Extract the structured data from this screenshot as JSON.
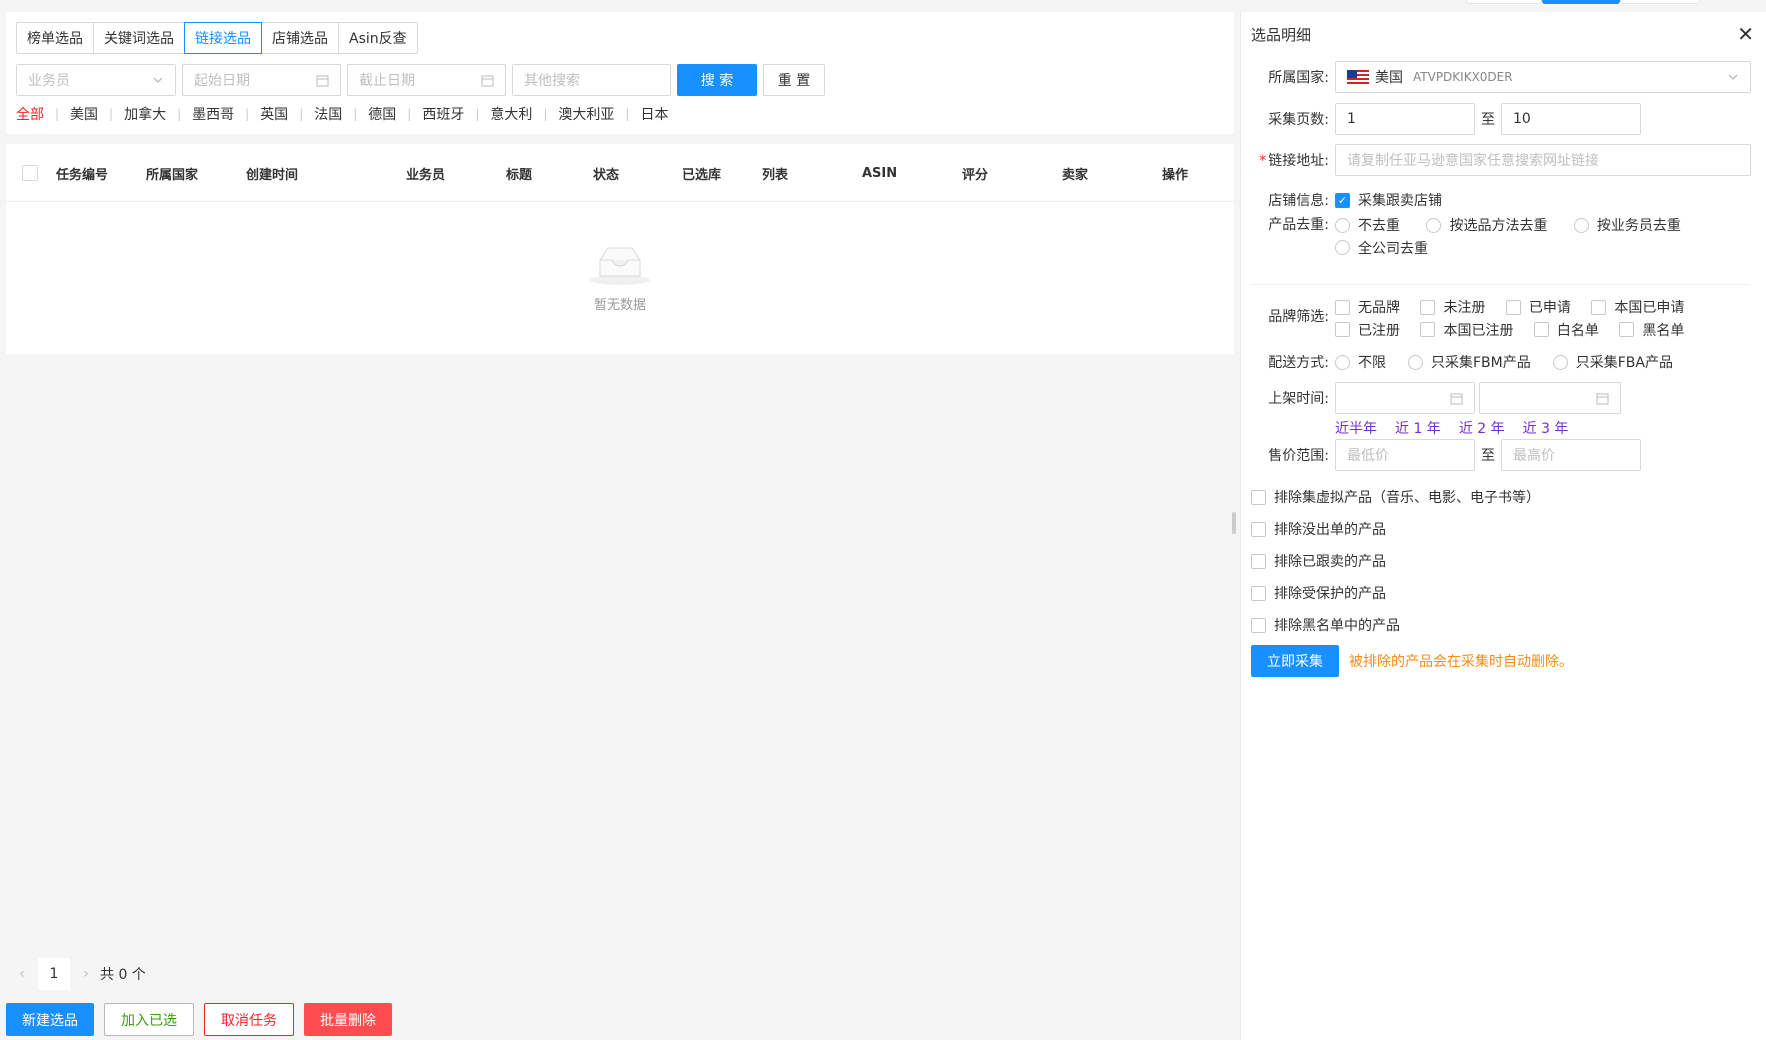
{
  "tabs": [
    {
      "label": "榜单选品",
      "active": false
    },
    {
      "label": "关键词选品",
      "active": false
    },
    {
      "label": "链接选品",
      "active": true
    },
    {
      "label": "店铺选品",
      "active": false
    },
    {
      "label": "Asin反查",
      "active": false
    }
  ],
  "filters": {
    "salesman_placeholder": "业务员",
    "start_date_placeholder": "起始日期",
    "end_date_placeholder": "截止日期",
    "other_search_placeholder": "其他搜索",
    "search_label": "搜 索",
    "reset_label": "重 置"
  },
  "countries": [
    "全部",
    "美国",
    "加拿大",
    "墨西哥",
    "英国",
    "法国",
    "德国",
    "西班牙",
    "意大利",
    "澳大利亚",
    "日本"
  ],
  "table": {
    "headers": [
      "任务编号",
      "所属国家",
      "创建时间",
      "业务员",
      "标题",
      "状态",
      "已选库",
      "列表",
      "ASIN",
      "评分",
      "卖家",
      "操作"
    ],
    "empty_text": "暂无数据"
  },
  "pager": {
    "prev": "‹",
    "page": "1",
    "next": "›",
    "total": "共 0 个"
  },
  "actions": {
    "new": "新建选品",
    "add": "加入已选",
    "cancel": "取消任务",
    "batch_delete": "批量删除"
  },
  "drawer": {
    "title": "选品明细",
    "close": "✕",
    "country_label": "所属国家:",
    "country_value": "美国",
    "country_code": "ATVPDKIKX0DER",
    "pages_label": "采集页数:",
    "pages_from": "1",
    "pages_to_sep": "至",
    "pages_to": "10",
    "link_label": "链接地址:",
    "link_placeholder": "请复制任亚马逊意国家任意搜索网址链接",
    "store_label": "店铺信息:",
    "store_option": "采集跟卖店铺",
    "dedup_label": "产品去重:",
    "dedup_options": [
      "不去重",
      "按选品方法去重",
      "按业务员去重",
      "全公司去重"
    ],
    "brand_label": "品牌筛选:",
    "brand_options": [
      "无品牌",
      "未注册",
      "已申请",
      "本国已申请",
      "已注册",
      "本国已注册",
      "白名单",
      "黑名单"
    ],
    "ship_label": "配送方式:",
    "ship_options": [
      "不限",
      "只采集FBM产品",
      "只采集FBA产品"
    ],
    "shelf_label": "上架时间:",
    "quick_ranges": [
      "近半年",
      "近 1 年",
      "近 2 年",
      "近 3 年"
    ],
    "price_label": "售价范围:",
    "price_min_placeholder": "最低价",
    "price_sep": "至",
    "price_max_placeholder": "最高价",
    "excludes": [
      "排除集虚拟产品（音乐、电影、电子书等）",
      "排除没出单的产品",
      "排除已跟卖的产品",
      "排除受保护的产品",
      "排除黑名单中的产品"
    ],
    "submit": "立即采集",
    "tip": "被排除的产品会在采集时自动删除。"
  },
  "colors": {
    "primary": "#1890ff",
    "danger": "#ff4d4f",
    "warning": "#fa8c16",
    "link": "#722ed1"
  }
}
